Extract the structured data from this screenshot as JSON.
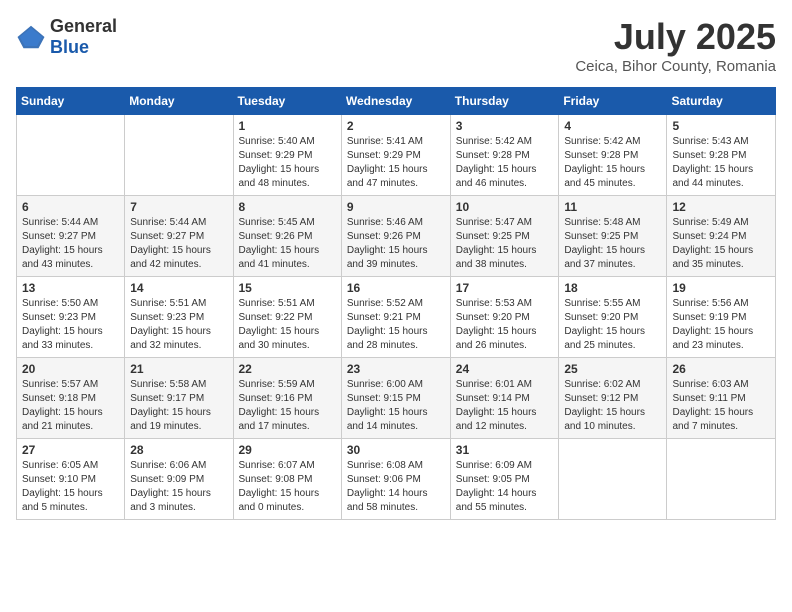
{
  "logo": {
    "general": "General",
    "blue": "Blue"
  },
  "title": "July 2025",
  "location": "Ceica, Bihor County, Romania",
  "days_of_week": [
    "Sunday",
    "Monday",
    "Tuesday",
    "Wednesday",
    "Thursday",
    "Friday",
    "Saturday"
  ],
  "weeks": [
    [
      {
        "day": "",
        "sunrise": "",
        "sunset": "",
        "daylight": ""
      },
      {
        "day": "",
        "sunrise": "",
        "sunset": "",
        "daylight": ""
      },
      {
        "day": "1",
        "sunrise": "Sunrise: 5:40 AM",
        "sunset": "Sunset: 9:29 PM",
        "daylight": "Daylight: 15 hours and 48 minutes."
      },
      {
        "day": "2",
        "sunrise": "Sunrise: 5:41 AM",
        "sunset": "Sunset: 9:29 PM",
        "daylight": "Daylight: 15 hours and 47 minutes."
      },
      {
        "day": "3",
        "sunrise": "Sunrise: 5:42 AM",
        "sunset": "Sunset: 9:28 PM",
        "daylight": "Daylight: 15 hours and 46 minutes."
      },
      {
        "day": "4",
        "sunrise": "Sunrise: 5:42 AM",
        "sunset": "Sunset: 9:28 PM",
        "daylight": "Daylight: 15 hours and 45 minutes."
      },
      {
        "day": "5",
        "sunrise": "Sunrise: 5:43 AM",
        "sunset": "Sunset: 9:28 PM",
        "daylight": "Daylight: 15 hours and 44 minutes."
      }
    ],
    [
      {
        "day": "6",
        "sunrise": "Sunrise: 5:44 AM",
        "sunset": "Sunset: 9:27 PM",
        "daylight": "Daylight: 15 hours and 43 minutes."
      },
      {
        "day": "7",
        "sunrise": "Sunrise: 5:44 AM",
        "sunset": "Sunset: 9:27 PM",
        "daylight": "Daylight: 15 hours and 42 minutes."
      },
      {
        "day": "8",
        "sunrise": "Sunrise: 5:45 AM",
        "sunset": "Sunset: 9:26 PM",
        "daylight": "Daylight: 15 hours and 41 minutes."
      },
      {
        "day": "9",
        "sunrise": "Sunrise: 5:46 AM",
        "sunset": "Sunset: 9:26 PM",
        "daylight": "Daylight: 15 hours and 39 minutes."
      },
      {
        "day": "10",
        "sunrise": "Sunrise: 5:47 AM",
        "sunset": "Sunset: 9:25 PM",
        "daylight": "Daylight: 15 hours and 38 minutes."
      },
      {
        "day": "11",
        "sunrise": "Sunrise: 5:48 AM",
        "sunset": "Sunset: 9:25 PM",
        "daylight": "Daylight: 15 hours and 37 minutes."
      },
      {
        "day": "12",
        "sunrise": "Sunrise: 5:49 AM",
        "sunset": "Sunset: 9:24 PM",
        "daylight": "Daylight: 15 hours and 35 minutes."
      }
    ],
    [
      {
        "day": "13",
        "sunrise": "Sunrise: 5:50 AM",
        "sunset": "Sunset: 9:23 PM",
        "daylight": "Daylight: 15 hours and 33 minutes."
      },
      {
        "day": "14",
        "sunrise": "Sunrise: 5:51 AM",
        "sunset": "Sunset: 9:23 PM",
        "daylight": "Daylight: 15 hours and 32 minutes."
      },
      {
        "day": "15",
        "sunrise": "Sunrise: 5:51 AM",
        "sunset": "Sunset: 9:22 PM",
        "daylight": "Daylight: 15 hours and 30 minutes."
      },
      {
        "day": "16",
        "sunrise": "Sunrise: 5:52 AM",
        "sunset": "Sunset: 9:21 PM",
        "daylight": "Daylight: 15 hours and 28 minutes."
      },
      {
        "day": "17",
        "sunrise": "Sunrise: 5:53 AM",
        "sunset": "Sunset: 9:20 PM",
        "daylight": "Daylight: 15 hours and 26 minutes."
      },
      {
        "day": "18",
        "sunrise": "Sunrise: 5:55 AM",
        "sunset": "Sunset: 9:20 PM",
        "daylight": "Daylight: 15 hours and 25 minutes."
      },
      {
        "day": "19",
        "sunrise": "Sunrise: 5:56 AM",
        "sunset": "Sunset: 9:19 PM",
        "daylight": "Daylight: 15 hours and 23 minutes."
      }
    ],
    [
      {
        "day": "20",
        "sunrise": "Sunrise: 5:57 AM",
        "sunset": "Sunset: 9:18 PM",
        "daylight": "Daylight: 15 hours and 21 minutes."
      },
      {
        "day": "21",
        "sunrise": "Sunrise: 5:58 AM",
        "sunset": "Sunset: 9:17 PM",
        "daylight": "Daylight: 15 hours and 19 minutes."
      },
      {
        "day": "22",
        "sunrise": "Sunrise: 5:59 AM",
        "sunset": "Sunset: 9:16 PM",
        "daylight": "Daylight: 15 hours and 17 minutes."
      },
      {
        "day": "23",
        "sunrise": "Sunrise: 6:00 AM",
        "sunset": "Sunset: 9:15 PM",
        "daylight": "Daylight: 15 hours and 14 minutes."
      },
      {
        "day": "24",
        "sunrise": "Sunrise: 6:01 AM",
        "sunset": "Sunset: 9:14 PM",
        "daylight": "Daylight: 15 hours and 12 minutes."
      },
      {
        "day": "25",
        "sunrise": "Sunrise: 6:02 AM",
        "sunset": "Sunset: 9:12 PM",
        "daylight": "Daylight: 15 hours and 10 minutes."
      },
      {
        "day": "26",
        "sunrise": "Sunrise: 6:03 AM",
        "sunset": "Sunset: 9:11 PM",
        "daylight": "Daylight: 15 hours and 7 minutes."
      }
    ],
    [
      {
        "day": "27",
        "sunrise": "Sunrise: 6:05 AM",
        "sunset": "Sunset: 9:10 PM",
        "daylight": "Daylight: 15 hours and 5 minutes."
      },
      {
        "day": "28",
        "sunrise": "Sunrise: 6:06 AM",
        "sunset": "Sunset: 9:09 PM",
        "daylight": "Daylight: 15 hours and 3 minutes."
      },
      {
        "day": "29",
        "sunrise": "Sunrise: 6:07 AM",
        "sunset": "Sunset: 9:08 PM",
        "daylight": "Daylight: 15 hours and 0 minutes."
      },
      {
        "day": "30",
        "sunrise": "Sunrise: 6:08 AM",
        "sunset": "Sunset: 9:06 PM",
        "daylight": "Daylight: 14 hours and 58 minutes."
      },
      {
        "day": "31",
        "sunrise": "Sunrise: 6:09 AM",
        "sunset": "Sunset: 9:05 PM",
        "daylight": "Daylight: 14 hours and 55 minutes."
      },
      {
        "day": "",
        "sunrise": "",
        "sunset": "",
        "daylight": ""
      },
      {
        "day": "",
        "sunrise": "",
        "sunset": "",
        "daylight": ""
      }
    ]
  ]
}
